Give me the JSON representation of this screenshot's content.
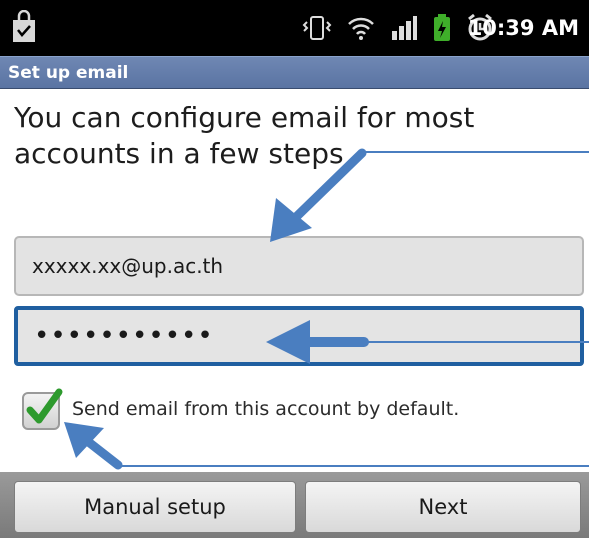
{
  "status_bar": {
    "time": "10:39 AM",
    "icons": [
      "shopping-bag-icon",
      "vibrate-icon",
      "wifi-icon",
      "signal-icon",
      "battery-charging-icon",
      "alarm-icon"
    ]
  },
  "header": {
    "title": "Set up email"
  },
  "main": {
    "intro": "You can configure email for most accounts in a few steps",
    "email_value": "xxxxx.xx@up.ac.th",
    "password_value": "•••••••••••",
    "default_checkbox_checked": true,
    "default_checkbox_label": "Send email from this account by default."
  },
  "footer": {
    "manual_setup_label": "Manual setup",
    "next_label": "Next"
  },
  "colors": {
    "title_bar": "#5f79a8",
    "focus_border": "#1f5fa0",
    "annotation_arrow": "#4a7ec0",
    "checkmark": "#2e9a2e"
  }
}
